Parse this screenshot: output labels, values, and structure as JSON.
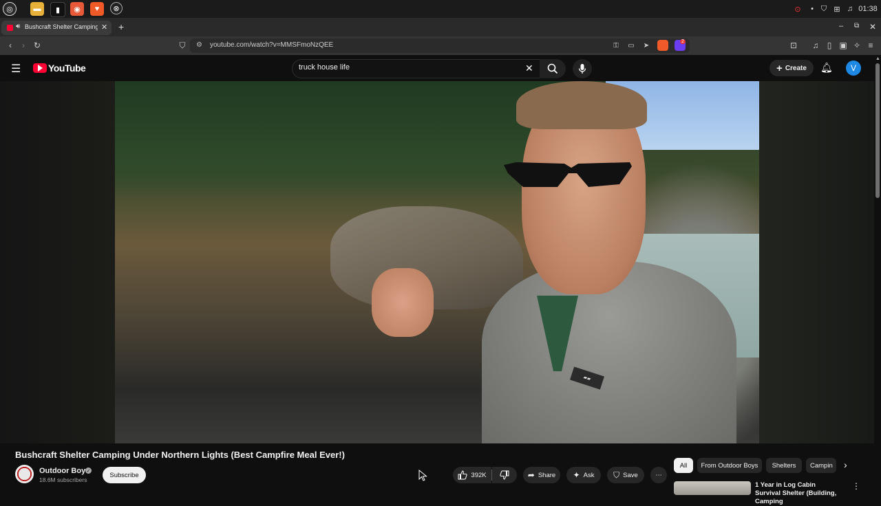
{
  "os": {
    "clock": "01:38",
    "apps": [
      "mint-menu",
      "files",
      "terminal",
      "firefox",
      "brave",
      "system-monitor"
    ]
  },
  "browser": {
    "tab_title": "Bushcraft Shelter Camping",
    "new_tab": "+",
    "url": "youtube.com/watch?v=MMSFmoNzQEE",
    "shield_badge": "2"
  },
  "youtube": {
    "logo_text": "YouTube",
    "search_value": "truck house life",
    "create_label": "Create",
    "avatar_letter": "V"
  },
  "video": {
    "title": "Bushcraft Shelter Camping Under Northern Lights (Best Campfire Meal Ever!)",
    "channel": "Outdoor Boys",
    "subscribers": "18.6M subscribers",
    "subscribe_label": "Subscribe",
    "likes": "392K",
    "share_label": "Share",
    "ask_label": "Ask",
    "save_label": "Save"
  },
  "chips": [
    "All",
    "From Outdoor Boys",
    "Shelters",
    "Campin"
  ],
  "recommendation": {
    "title": "1 Year in Log Cabin Survival Shelter (Building, Camping"
  }
}
